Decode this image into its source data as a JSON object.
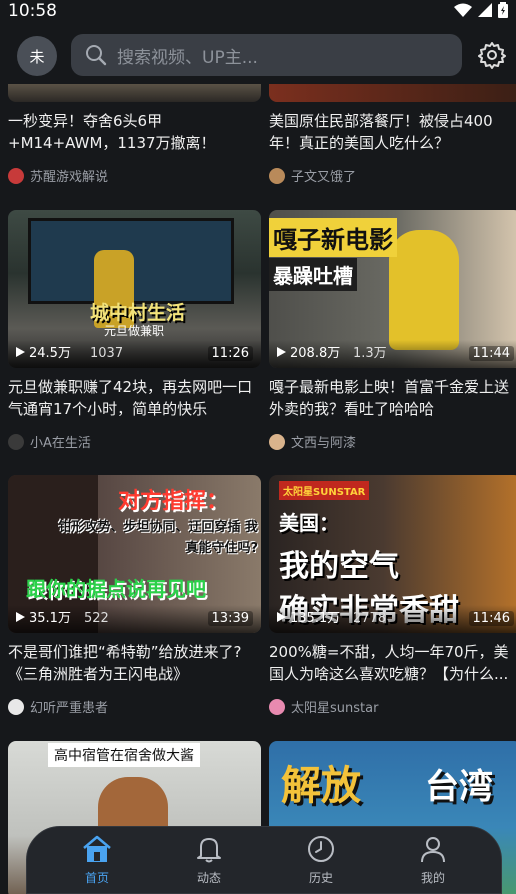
{
  "status_bar": {
    "time": "10:58"
  },
  "header": {
    "avatar_text": "未",
    "search_placeholder": "搜索视频、UP主..."
  },
  "feed": {
    "cards": [
      {
        "title": "一秒变异！夺舍6头6甲+M14+AWM，1137万撤离！",
        "author": "苏醒游戏解说"
      },
      {
        "title": "美国原住民部落餐厅！被侵占400年！真正的美国人吃什么？",
        "author": "子文又饿了"
      },
      {
        "title": "元旦做兼职赚了42块，再去网吧一口气通宵17个小时，简单的快乐",
        "author": "小A在生活",
        "views": "24.5万",
        "danmaku": "1037",
        "duration": "11:26",
        "overlay": "城中村生活",
        "overlay_sub": "元旦做兼职"
      },
      {
        "title": "嘎子最新电影上映！首富千金爱上送外卖的我？看吐了哈哈哈",
        "author": "文西与阿漆",
        "views": "208.8万",
        "danmaku": "1.3万",
        "duration": "11:44",
        "overlay": "嘎子新电影",
        "overlay_sub": "暴躁吐槽"
      },
      {
        "title": "不是哥们谁把“希特勒”给放进来了?《三角洲胜者为王闪电战》",
        "author": "幻听严重患者",
        "views": "35.1万",
        "danmaku": "522",
        "duration": "13:39",
        "overlay": "对方指挥：",
        "overlay_sub": "钳形攻势、步坦协同、迂回穿插 我真能守住吗?",
        "overlay_bottom": "跟你的据点说再见吧"
      },
      {
        "title": "200%糖=不甜，人均一年70斤，美国人为啥这么喜欢吃糖？【为什么...",
        "author": "太阳星sunstar",
        "views": "135.1万",
        "danmaku": "2778",
        "duration": "11:46",
        "overlay": "美国：",
        "overlay_sub": "我的空气",
        "overlay_bottom": "确实非常香甜",
        "brand": "太阳星SUNSTAR"
      },
      {
        "title": "",
        "author": "",
        "overlay": "高中宿管在宿舍做大酱"
      },
      {
        "title": "",
        "author": "",
        "overlay": "解放",
        "overlay_sub": "台湾"
      }
    ]
  },
  "tabbar": {
    "tabs": [
      {
        "label": "首页",
        "icon": "home-icon",
        "active": true
      },
      {
        "label": "动态",
        "icon": "bell-icon",
        "active": false
      },
      {
        "label": "历史",
        "icon": "clock-icon",
        "active": false
      },
      {
        "label": "我的",
        "icon": "person-icon",
        "active": false
      }
    ]
  },
  "colors": {
    "accent": "#4aa3f0",
    "background": "#16181b"
  }
}
